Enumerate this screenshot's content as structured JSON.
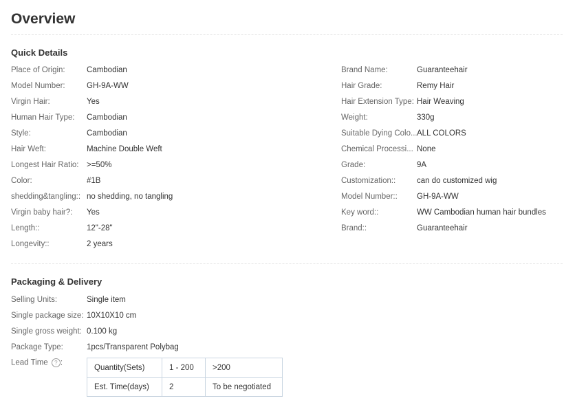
{
  "title": "Overview",
  "quick_details": {
    "heading": "Quick Details",
    "left": [
      {
        "label": "Place of Origin:",
        "value": "Cambodian"
      },
      {
        "label": "Model Number:",
        "value": "GH-9A-WW"
      },
      {
        "label": "Virgin Hair:",
        "value": "Yes"
      },
      {
        "label": "Human Hair Type:",
        "value": "Cambodian"
      },
      {
        "label": "Style:",
        "value": "Cambodian"
      },
      {
        "label": "Hair Weft:",
        "value": "Machine Double Weft"
      },
      {
        "label": "Longest Hair Ratio:",
        "value": ">=50%"
      },
      {
        "label": "Color:",
        "value": "#1B"
      },
      {
        "label": "shedding&tangling::",
        "value": "no shedding, no tangling"
      },
      {
        "label": "Virgin baby hair?:",
        "value": "Yes"
      },
      {
        "label": "Length::",
        "value": "12\"-28\""
      },
      {
        "label": "Longevity::",
        "value": "2 years"
      }
    ],
    "right": [
      {
        "label": "Brand Name:",
        "value": "Guaranteehair"
      },
      {
        "label": "Hair Grade:",
        "value": "Remy Hair"
      },
      {
        "label": "Hair Extension Type:",
        "value": "Hair Weaving"
      },
      {
        "label": "Weight:",
        "value": "330g"
      },
      {
        "label": "Suitable Dying Colo...",
        "value": "ALL COLORS"
      },
      {
        "label": "Chemical Processi...",
        "value": "None"
      },
      {
        "label": "Grade:",
        "value": "9A"
      },
      {
        "label": "Customization::",
        "value": "can do customized wig"
      },
      {
        "label": "Model Number::",
        "value": "GH-9A-WW"
      },
      {
        "label": "Key word::",
        "value": "WW Cambodian human hair bundles"
      },
      {
        "label": "Brand::",
        "value": "Guaranteehair"
      }
    ]
  },
  "packaging": {
    "heading": "Packaging & Delivery",
    "rows": [
      {
        "label": "Selling Units:",
        "value": "Single item"
      },
      {
        "label": "Single package size:",
        "value": "10X10X10 cm"
      },
      {
        "label": "Single gross weight:",
        "value": "0.100 kg"
      },
      {
        "label": "Package Type:",
        "value": "1pcs/Transparent Polybag"
      }
    ],
    "lead_time_label": "Lead Time",
    "lead_time_suffix": ":",
    "help_icon": "question-circle-icon",
    "help_glyph": "?",
    "lead_table": [
      [
        "Quantity(Sets)",
        "1 - 200",
        ">200"
      ],
      [
        "Est. Time(days)",
        "2",
        "To be negotiated"
      ]
    ]
  }
}
